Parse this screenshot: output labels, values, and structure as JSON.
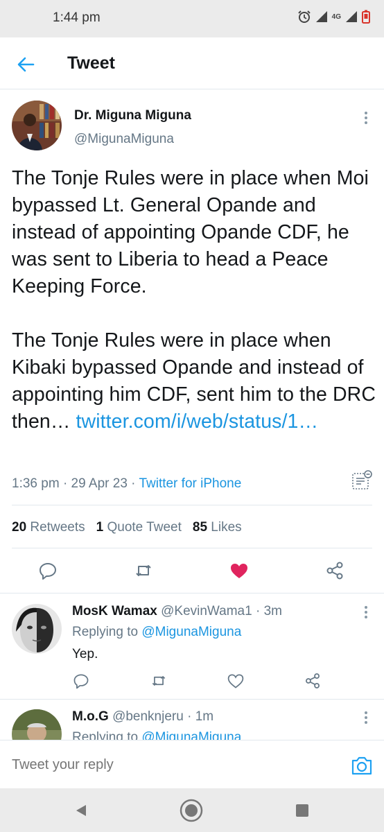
{
  "status_bar": {
    "time": "1:44 pm",
    "network": "4G",
    "icons": [
      "alarm-icon",
      "signal-icon",
      "battery-low-icon"
    ]
  },
  "header": {
    "title": "Tweet",
    "back_icon": "arrow-left-icon"
  },
  "tweet": {
    "author_name": "Dr. Miguna Miguna",
    "author_handle": "@MigunaMiguna",
    "body": "The Tonje Rules were in place when Moi bypassed Lt. General Opande and instead of appointing Opande CDF, he was sent to Liberia to head a Peace Keeping Force.\n\nThe Tonje Rules were in place when Kibaki bypassed Opande and instead of appointing him CDF, sent him to the DRC then… ",
    "link": "twitter.com/i/web/status/1…",
    "time": "1:36 pm",
    "date": "29 Apr 23",
    "source": "Twitter for iPhone",
    "meta_separator": "·",
    "stats": {
      "retweets_count": "20",
      "retweets_label": "Retweets",
      "quotes_count": "1",
      "quotes_label": "Quote Tweet",
      "likes_count": "85",
      "likes_label": "Likes"
    },
    "liked": true
  },
  "replies": [
    {
      "name": "MosK Wamax",
      "handle": "@KevinWama1",
      "age": "· 3m",
      "replying_prefix": "Replying to",
      "replying_to": "@MigunaMiguna",
      "text": "Yep."
    },
    {
      "name": "M.o.G",
      "handle": "@benknjeru",
      "age": "· 1m",
      "replying_prefix": "Replying to",
      "replying_to": "@MigunaMiguna",
      "text": ""
    }
  ],
  "reply_bar": {
    "placeholder": "Tweet your reply"
  },
  "colors": {
    "accent": "#1da1f2",
    "link": "#1b95e0",
    "like": "#e0245e",
    "muted": "#657786",
    "text": "#14171a"
  }
}
